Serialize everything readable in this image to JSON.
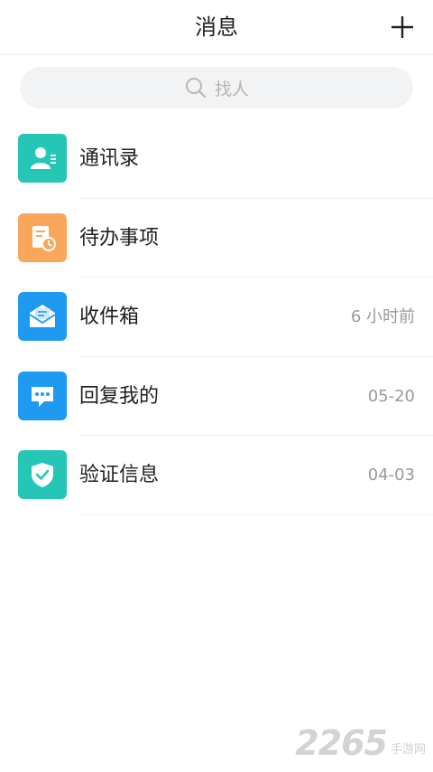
{
  "header": {
    "title": "消息"
  },
  "search": {
    "placeholder": "找人"
  },
  "items": [
    {
      "label": "通讯录",
      "time": "",
      "icon": "contacts-icon",
      "color": "#26c6b6"
    },
    {
      "label": "待办事项",
      "time": "",
      "icon": "todo-icon",
      "color": "#f9a85b"
    },
    {
      "label": "收件箱",
      "time": "6 小时前",
      "icon": "inbox-icon",
      "color": "#1e9bf0"
    },
    {
      "label": "回复我的",
      "time": "05-20",
      "icon": "reply-icon",
      "color": "#1e9bf0"
    },
    {
      "label": "验证信息",
      "time": "04-03",
      "icon": "verify-icon",
      "color": "#26c6b6"
    }
  ],
  "watermark": {
    "digits": "2265",
    "text": "手游网"
  }
}
